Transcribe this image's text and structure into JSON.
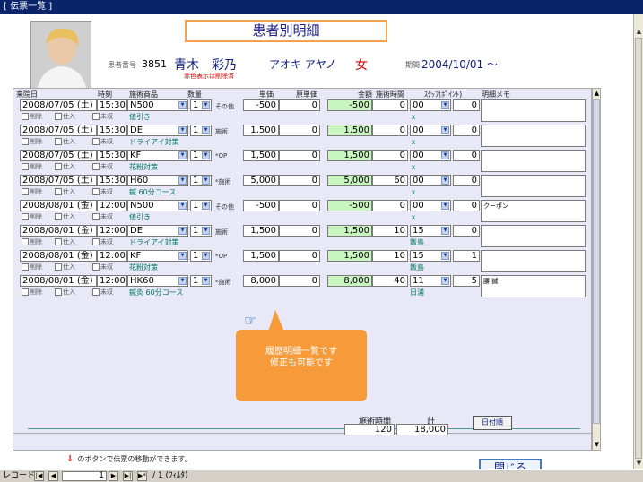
{
  "window": {
    "title": "[ 伝票一覧 ]"
  },
  "header": {
    "form_title": "患者別明細",
    "patient_id_label": "患者番号",
    "patient_id": "3851",
    "name": "青木　彩乃",
    "kana": "アオキ アヤノ",
    "sex": "女",
    "note": "赤色表示は削除済",
    "period_label": "期間",
    "period_value": "2004/10/01 ～"
  },
  "columns": [
    "来院日",
    "時刻",
    "施術商品",
    "数量",
    "単価",
    "原単価",
    "金額",
    "施術時間",
    "ｽﾀｯﾌ(ﾎﾟｲﾝﾄ)",
    "明細メモ"
  ],
  "sub_labels": {
    "delete": "削除",
    "purchase": "仕入",
    "unpaid": "未収"
  },
  "rows": [
    {
      "date": "2008/07/05 (土)",
      "time": "15:30",
      "item": "N500",
      "qty": "1",
      "category": "その他",
      "price": "-500",
      "cost": "0",
      "amount": "-500",
      "duration": "0",
      "staff": "00",
      "points": "0",
      "memo": "",
      "desc": "値引き",
      "staff_name": "ｘ"
    },
    {
      "date": "2008/07/05 (土)",
      "time": "15:30",
      "item": "DE",
      "qty": "1",
      "category": "施術",
      "price": "1,500",
      "cost": "0",
      "amount": "1,500",
      "duration": "0",
      "staff": "00",
      "points": "0",
      "memo": "",
      "desc": "ドライアイ対策",
      "staff_name": "ｘ"
    },
    {
      "date": "2008/07/05 (土)",
      "time": "15:30",
      "item": "KF",
      "qty": "1",
      "category": "*OP",
      "price": "1,500",
      "cost": "0",
      "amount": "1,500",
      "duration": "0",
      "staff": "00",
      "points": "0",
      "memo": "",
      "desc": "花粉対策",
      "staff_name": "ｘ"
    },
    {
      "date": "2008/07/05 (土)",
      "time": "15:30",
      "item": "H60",
      "qty": "1",
      "category": "*施術",
      "price": "5,000",
      "cost": "0",
      "amount": "5,000",
      "duration": "60",
      "staff": "00",
      "points": "0",
      "memo": "",
      "desc": "鍼 60分コース",
      "staff_name": "ｘ"
    },
    {
      "date": "2008/08/01 (金)",
      "time": "12:00",
      "item": "N500",
      "qty": "1",
      "category": "その他",
      "price": "-500",
      "cost": "0",
      "amount": "-500",
      "duration": "0",
      "staff": "00",
      "points": "0",
      "memo": "クーポン",
      "desc": "値引き",
      "staff_name": "ｘ"
    },
    {
      "date": "2008/08/01 (金)",
      "time": "12:00",
      "item": "DE",
      "qty": "1",
      "category": "施術",
      "price": "1,500",
      "cost": "0",
      "amount": "1,500",
      "duration": "10",
      "staff": "15",
      "points": "0",
      "memo": "",
      "desc": "ドライアイ対策",
      "staff_name": "飯島"
    },
    {
      "date": "2008/08/01 (金)",
      "time": "12:00",
      "item": "KF",
      "qty": "1",
      "category": "*OP",
      "price": "1,500",
      "cost": "0",
      "amount": "1,500",
      "duration": "10",
      "staff": "15",
      "points": "1",
      "memo": "",
      "desc": "花粉対策",
      "staff_name": "飯島"
    },
    {
      "date": "2008/08/01 (金)",
      "time": "12:00",
      "item": "HK60",
      "qty": "1",
      "category": "*施術",
      "price": "8,000",
      "cost": "0",
      "amount": "8,000",
      "duration": "40",
      "staff": "11",
      "points": "5",
      "memo": "腰 鍼",
      "desc": "鍼灸 60分コース",
      "staff_name": "日浦"
    }
  ],
  "totals": {
    "duration_label": "施術時間",
    "duration": "120",
    "amount_label": "計",
    "amount": "18,000"
  },
  "buttons": {
    "sort_date": "日付順",
    "close": "閉じる"
  },
  "tooltip": {
    "line1": "履歴明細一覧です",
    "line2": "修正も可能です"
  },
  "help_text": "のボタンで伝票の移動ができます。",
  "status": {
    "record_label": "レコード:",
    "current": "1",
    "total": "/ 1 (ﾌｨﾙﾀ)"
  }
}
